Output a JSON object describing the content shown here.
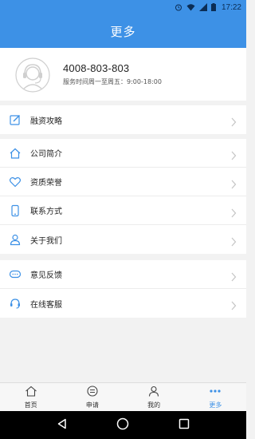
{
  "status_bar": {
    "time": "17:22"
  },
  "header": {
    "title": "更多"
  },
  "contact": {
    "phone": "4008-803-803",
    "hours": "服务时间周一至周五：9:00-18:00"
  },
  "menu": {
    "group1": [
      {
        "label": "融资攻略",
        "icon": "edit-icon"
      }
    ],
    "group2": [
      {
        "label": "公司简介",
        "icon": "home-icon"
      },
      {
        "label": "资质荣誉",
        "icon": "heart-icon"
      },
      {
        "label": "联系方式",
        "icon": "phone-icon"
      },
      {
        "label": "关于我们",
        "icon": "person-icon"
      }
    ],
    "group3": [
      {
        "label": "意见反馈",
        "icon": "chat-bubble-icon"
      },
      {
        "label": "在线客服",
        "icon": "headset-icon"
      }
    ]
  },
  "tabs": [
    {
      "label": "首页",
      "icon": "home-icon"
    },
    {
      "label": "申请",
      "icon": "application-icon"
    },
    {
      "label": "我的",
      "icon": "person-icon"
    },
    {
      "label": "更多",
      "icon": "more-dots-icon",
      "active": true
    }
  ],
  "colors": {
    "primary": "#3d91e6",
    "background": "#f2f2f2",
    "nav_bar": "#000000"
  }
}
